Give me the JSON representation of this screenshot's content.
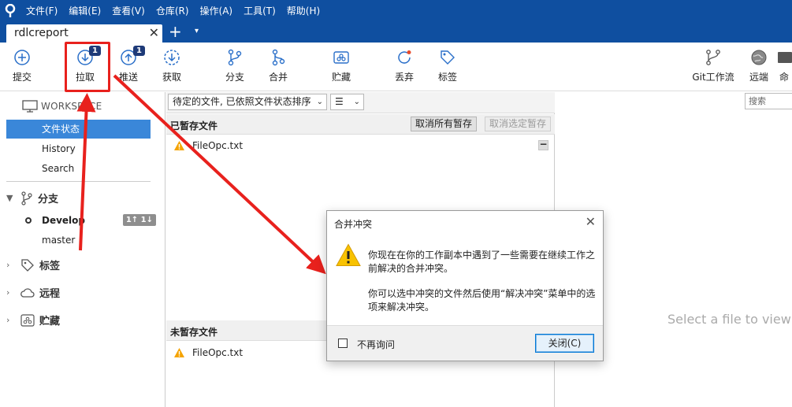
{
  "menu": [
    "文件(F)",
    "编辑(E)",
    "查看(V)",
    "仓库(R)",
    "操作(A)",
    "工具(T)",
    "帮助(H)"
  ],
  "tab": {
    "title": "rdlcreport",
    "close": "✕",
    "add": "+",
    "menu": "▾"
  },
  "toolbar": {
    "commit": "提交",
    "pull": "拉取",
    "pull_badge": "1",
    "push": "推送",
    "push_badge": "1",
    "fetch": "获取",
    "branch": "分支",
    "merge": "合并",
    "stash": "贮藏",
    "discard": "丢弃",
    "tag": "标签",
    "gitflow": "Git工作流",
    "remote": "远端",
    "terminal": "命"
  },
  "sidebar": {
    "workspace": "WORKSPACE",
    "items": [
      "文件状态",
      "History",
      "Search"
    ],
    "branches_title": "分支",
    "branches": [
      {
        "name": "Develop",
        "track": "1↑ 1↓"
      },
      {
        "name": "master"
      }
    ],
    "tags_title": "标签",
    "remotes_title": "远程",
    "stashes_title": "贮藏"
  },
  "filter": {
    "sort": "待定的文件, 已依照文件状态排序",
    "view": "☰"
  },
  "staged": {
    "title": "已暂存文件",
    "unstage_all": "取消所有暂存",
    "unstage_selected": "取消选定暂存",
    "files": [
      "FileOpc.txt"
    ],
    "collapse": "−"
  },
  "unstaged": {
    "title": "未暂存文件",
    "files": [
      "FileOpc.txt"
    ]
  },
  "right": {
    "search_placeholder": "搜索",
    "placeholder": "Select a file to view t"
  },
  "dialog": {
    "title": "合并冲突",
    "close": "✕",
    "message1": "你现在在你的工作副本中遇到了一些需要在继续工作之前解决的合并冲突。",
    "message2": "你可以选中冲突的文件然后使用“解决冲突”菜单中的选项来解决冲突。",
    "checkbox": "不再询问",
    "button": "关闭(C)"
  },
  "colors": {
    "accent": "#0f4fa0",
    "selection": "#3a87d9",
    "annotation": "#e8211d",
    "warning": "#f5b400"
  }
}
